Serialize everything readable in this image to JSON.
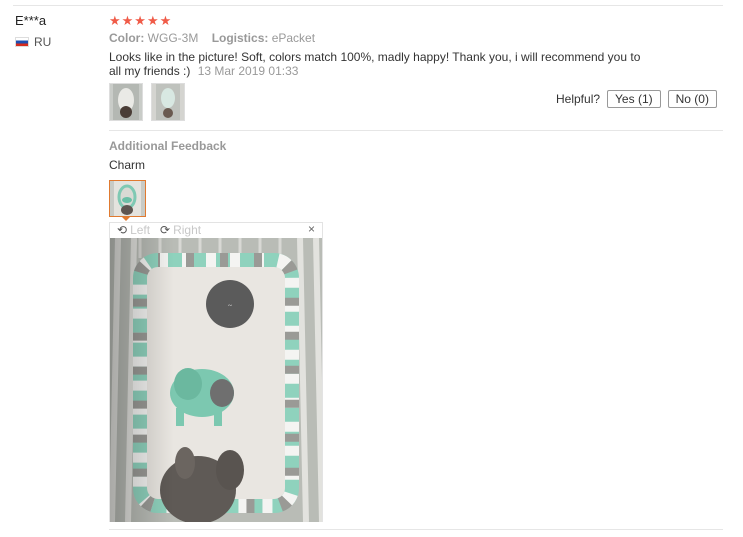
{
  "review": {
    "user": "E***a",
    "country": "RU",
    "rating_text": "★★★★★",
    "rating": 5,
    "color_label": "Color:",
    "color_value": "WGG-3M",
    "logistics_label": "Logistics:",
    "logistics_value": "ePacket",
    "text": "Looks like in the picture! Soft, colors match 100%, madly happy! Thank you, i will recommend you to all my friends :)",
    "date": "13 Mar 2019 01:33",
    "helpful_label": "Helpful?",
    "yes_label": "Yes (1)",
    "no_label": "No (0)"
  },
  "additional": {
    "heading": "Additional Feedback",
    "text": "Charm"
  },
  "viewer": {
    "rotate_left_label": "Left",
    "rotate_right_label": "Right",
    "close_glyph": "×",
    "rotate_left_icon": "rotate-left-icon",
    "rotate_right_icon": "rotate-right-icon",
    "close_icon": "close-icon"
  },
  "colors": {
    "star": "#f05b48",
    "selected_border": "#e07a30",
    "muted": "#999999"
  }
}
